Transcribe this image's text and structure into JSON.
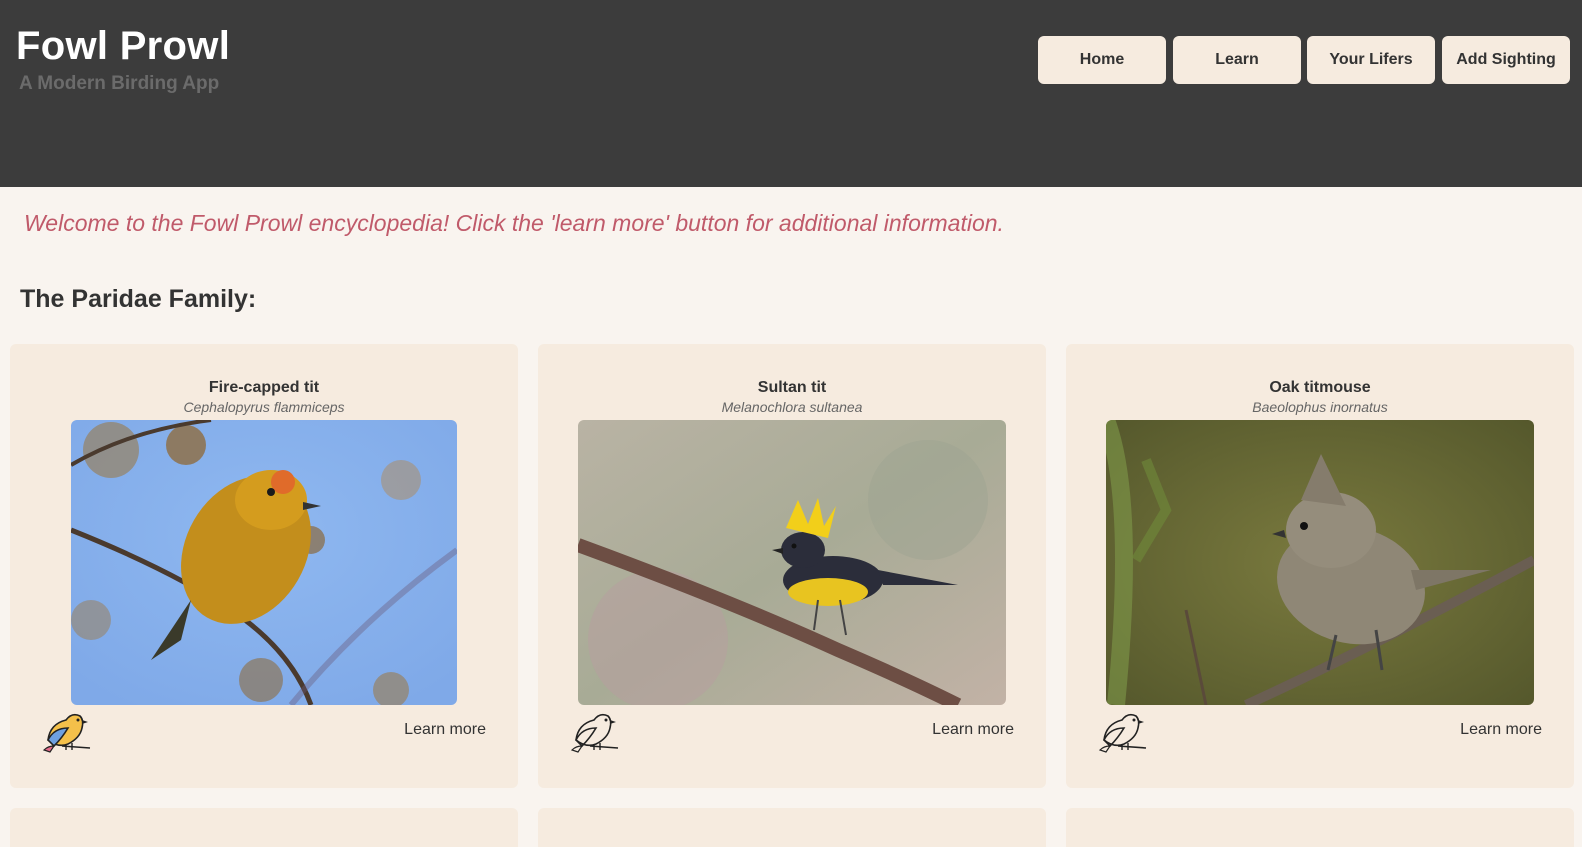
{
  "header": {
    "title": "Fowl Prowl",
    "subtitle": "A Modern Birding App"
  },
  "nav": {
    "items": [
      {
        "label": "Home"
      },
      {
        "label": "Learn"
      },
      {
        "label": "Your Lifers"
      },
      {
        "label": "Add Sighting"
      }
    ]
  },
  "main": {
    "welcome": "Welcome to the Fowl Prowl encyclopedia! Click the 'learn more' button for additional information.",
    "section_title": "The Paridae Family:",
    "cards": [
      {
        "common_name": "Fire-capped tit",
        "scientific_name": "Cephalopyrus flammiceps",
        "learn_more_label": "Learn more",
        "lifer_icon": "colored-bird-icon"
      },
      {
        "common_name": "Sultan tit",
        "scientific_name": "Melanochlora sultanea",
        "learn_more_label": "Learn more",
        "lifer_icon": "outline-bird-icon"
      },
      {
        "common_name": "Oak titmouse",
        "scientific_name": "Baeolophus inornatus",
        "learn_more_label": "Learn more",
        "lifer_icon": "outline-bird-icon"
      }
    ]
  },
  "colors": {
    "header_bg": "#3c3c3c",
    "page_bg": "#f9f4ef",
    "card_bg": "#f6ebdf",
    "welcome_text": "#c05a6a"
  }
}
